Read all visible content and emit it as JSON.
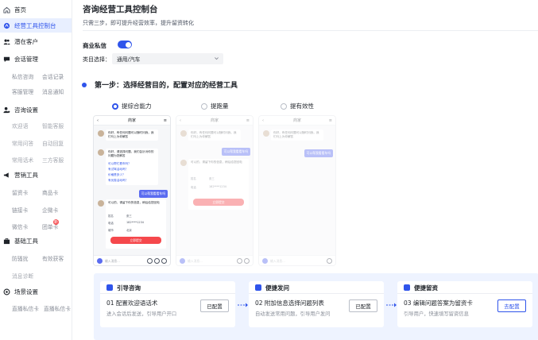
{
  "sidebar": {
    "home": "首页",
    "console": "经营工具控制台",
    "potential_customers": "潜在客户",
    "session_mgmt": {
      "label": "会话管理",
      "items": [
        "私信咨询",
        "会话记录",
        "客服管理",
        "消息通知"
      ]
    },
    "consult_settings": {
      "label": "咨询设置",
      "items": [
        "欢迎语",
        "智能客服",
        "常用问答",
        "常用话术",
        "自动回复",
        "三方客服"
      ]
    },
    "marketing_tools": {
      "label": "营销工具",
      "items": [
        "留资卡",
        "商品卡",
        "链接卡",
        "企微卡",
        "微信卡",
        "团单卡"
      ]
    },
    "basic_tools": {
      "label": "基础工具",
      "items": [
        "防骚扰",
        "有效获客",
        "消息诊断"
      ]
    },
    "scene_settings": {
      "label": "场景设置",
      "items": [
        "直播私信卡",
        "直播私信卡"
      ]
    },
    "badge_count": "新"
  },
  "main": {
    "title": "咨询经营工具控制台",
    "subtitle": "只需三步，即可提升经营效率，提升留资转化",
    "business_dm_label": "商业私信",
    "business_dm_on": true,
    "category_label": "类目选择：",
    "category_value": "通用/汽车",
    "step1_title": "第一步：选择经营目的，配置对应的经营工具",
    "purposes": [
      {
        "label": "提综合能力",
        "selected": true
      },
      {
        "label": "提跑量",
        "selected": false
      },
      {
        "label": "提有效性",
        "selected": false
      }
    ],
    "flow": [
      {
        "head": "引导咨询",
        "title": "01 配置欢迎语话术",
        "desc": "进入会话后发送，引导用户开口",
        "button": "已配置"
      },
      {
        "head": "便捷发问",
        "title": "02 附加信息选择问题列表",
        "desc": "自动发送常用问题，引导用户发问",
        "button": "已配置"
      },
      {
        "head": "便捷留资",
        "title": "03 编辑问题答案为留资卡",
        "desc": "引导用户，快速填写留资信息",
        "button": "去配置"
      }
    ]
  },
  "phone_preview": {
    "header": "商家",
    "greeting": "你好，有任何问题可以随时问我，我们马上为你解答",
    "questions_intro": "你好，请选择问题，我们会针对你的问题为您解答",
    "q1": "可以帮忙看车吗？",
    "q2": "有试驾活动吗？",
    "q3": "价格是多少？",
    "q4": "有优惠活动吗？",
    "user_msg": "可以帮我看看车吗",
    "form_intro": "可以的，请留下你的信息，稍后给您回电",
    "name_label": "姓名",
    "name_value": "张三",
    "phone_label": "电话",
    "phone_value": "182****1234",
    "city_label": "城市",
    "city_value": "北京",
    "submit": "立即提交",
    "input_placeholder": "输入消息..."
  },
  "colors": {
    "accent": "#2f54eb",
    "danger": "#f5484c",
    "flow_bg": "#eef3ff"
  }
}
